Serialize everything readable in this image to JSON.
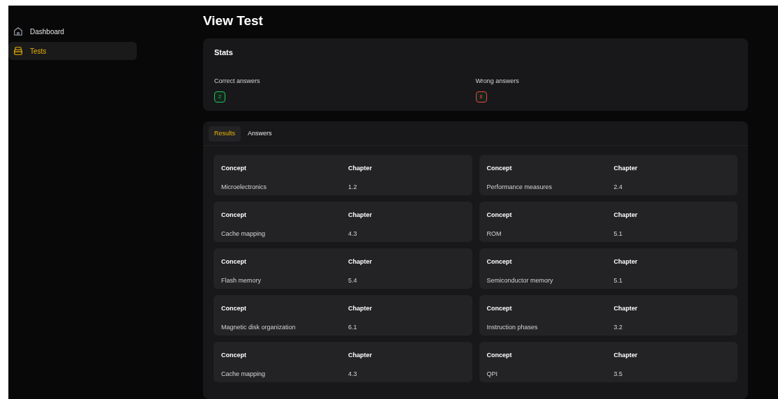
{
  "sidebar": {
    "items": [
      {
        "label": "Dashboard",
        "kind": "home",
        "selected": false
      },
      {
        "label": "Tests",
        "kind": "box",
        "selected": true
      }
    ]
  },
  "page": {
    "title": "View Test"
  },
  "stats": {
    "title": "Stats",
    "items": [
      {
        "label": "Correct answers",
        "value": "2",
        "color": "#22c55e"
      },
      {
        "label": "Wrong answers",
        "value": "8",
        "color": "#ef4444"
      }
    ]
  },
  "tabs": [
    {
      "label": "Results",
      "selected": true
    },
    {
      "label": "Answers",
      "selected": false
    }
  ],
  "results": {
    "rows": [
      {
        "concept_label": "Concept",
        "chapter_label": "Chapter",
        "concept": "Microelectronics",
        "chapter": "1.2"
      },
      {
        "concept_label": "Concept",
        "chapter_label": "Chapter",
        "concept": "Performance measures",
        "chapter": "2.4"
      },
      {
        "concept_label": "Concept",
        "chapter_label": "Chapter",
        "concept": "Cache mapping",
        "chapter": "4.3"
      },
      {
        "concept_label": "Concept",
        "chapter_label": "Chapter",
        "concept": "ROM",
        "chapter": "5.1"
      },
      {
        "concept_label": "Concept",
        "chapter_label": "Chapter",
        "concept": "Flash memory",
        "chapter": "5.4"
      },
      {
        "concept_label": "Concept",
        "chapter_label": "Chapter",
        "concept": "Semiconductor memory",
        "chapter": "5.1"
      },
      {
        "concept_label": "Concept",
        "chapter_label": "Chapter",
        "concept": "Magnetic disk organization",
        "chapter": "6.1"
      },
      {
        "concept_label": "Concept",
        "chapter_label": "Chapter",
        "concept": "Instruction phases",
        "chapter": "3.2"
      },
      {
        "concept_label": "Concept",
        "chapter_label": "Chapter",
        "concept": "Cache mapping",
        "chapter": "4.3"
      },
      {
        "concept_label": "Concept",
        "chapter_label": "Chapter",
        "concept": "QPI",
        "chapter": "3.5"
      }
    ]
  }
}
